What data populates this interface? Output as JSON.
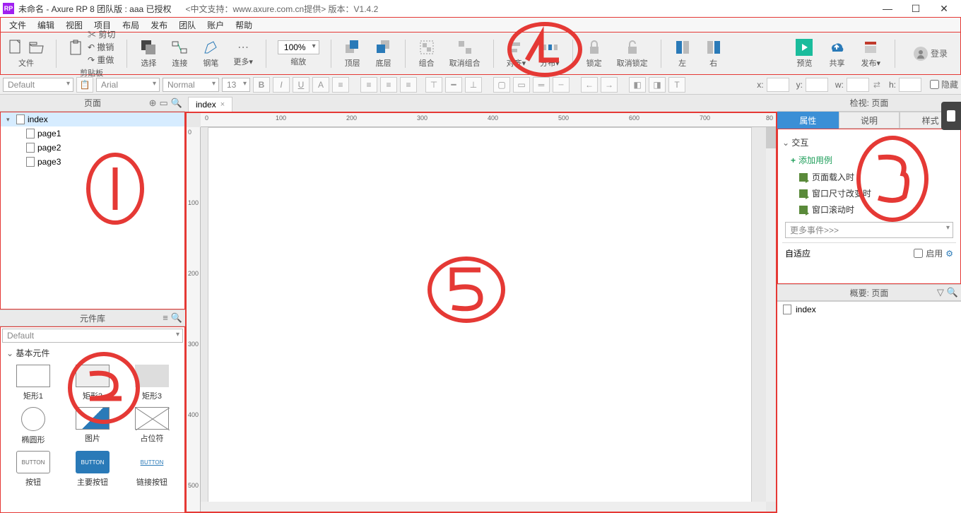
{
  "titlebar": {
    "app_icon_text": "RP",
    "title": "未命名 - Axure RP 8 团队版 : aaa 已授权",
    "extra": "<中文支持：www.axure.com.cn提供> 版本：V1.4.2"
  },
  "menu": [
    "文件",
    "编辑",
    "视图",
    "项目",
    "布局",
    "发布",
    "团队",
    "账户",
    "帮助"
  ],
  "toolbar": {
    "file": "文件",
    "clipboard": "剪贴板",
    "cut": "剪切",
    "undo": "撤销",
    "redo": "重做",
    "select": "选择",
    "connect": "连接",
    "pen": "钢笔",
    "more": "更多▾",
    "zoom_value": "100%",
    "zoom_label": "缩放",
    "top": "顶层",
    "bottom": "底层",
    "group": "组合",
    "ungroup": "取消组合",
    "align": "对齐▾",
    "distribute": "分布▾",
    "lock": "锁定",
    "unlock": "取消锁定",
    "left": "左",
    "right": "右",
    "preview": "预览",
    "share": "共享",
    "publish": "发布▾",
    "login": "登录"
  },
  "stylebar": {
    "style_preset": "Default",
    "font": "Arial",
    "weight": "Normal",
    "size": "13",
    "x_label": "x:",
    "y_label": "y:",
    "w_label": "w:",
    "h_label": "h:",
    "hidden": "隐藏"
  },
  "pages_panel": {
    "title": "页面",
    "root": "index",
    "children": [
      "page1",
      "page2",
      "page3"
    ]
  },
  "lib_panel": {
    "title": "元件库",
    "selected": "Default",
    "section": "基本元件",
    "widgets": [
      "矩形1",
      "矩形2",
      "矩形3",
      "椭圆形",
      "图片",
      "占位符",
      "按钮",
      "主要按钮",
      "链接按钮"
    ],
    "button_badge": "BUTTON"
  },
  "tabs": {
    "tab1": "index"
  },
  "ruler_h": [
    "0",
    "100",
    "200",
    "300",
    "400",
    "500",
    "600",
    "700",
    "80"
  ],
  "ruler_v": [
    "0",
    "100",
    "200",
    "300",
    "400",
    "500"
  ],
  "inspector": {
    "header": "检视: 页面",
    "tab_props": "属性",
    "tab_notes": "说明",
    "tab_style": "样式",
    "section": "交互",
    "add_case": "添加用例",
    "events": [
      "页面载入时",
      "窗口尺寸改变时",
      "窗口滚动时"
    ],
    "more_events": "更多事件>>>",
    "adaptive": "自适应",
    "enable": "启用"
  },
  "outline": {
    "header": "概要: 页面",
    "item": "index"
  }
}
